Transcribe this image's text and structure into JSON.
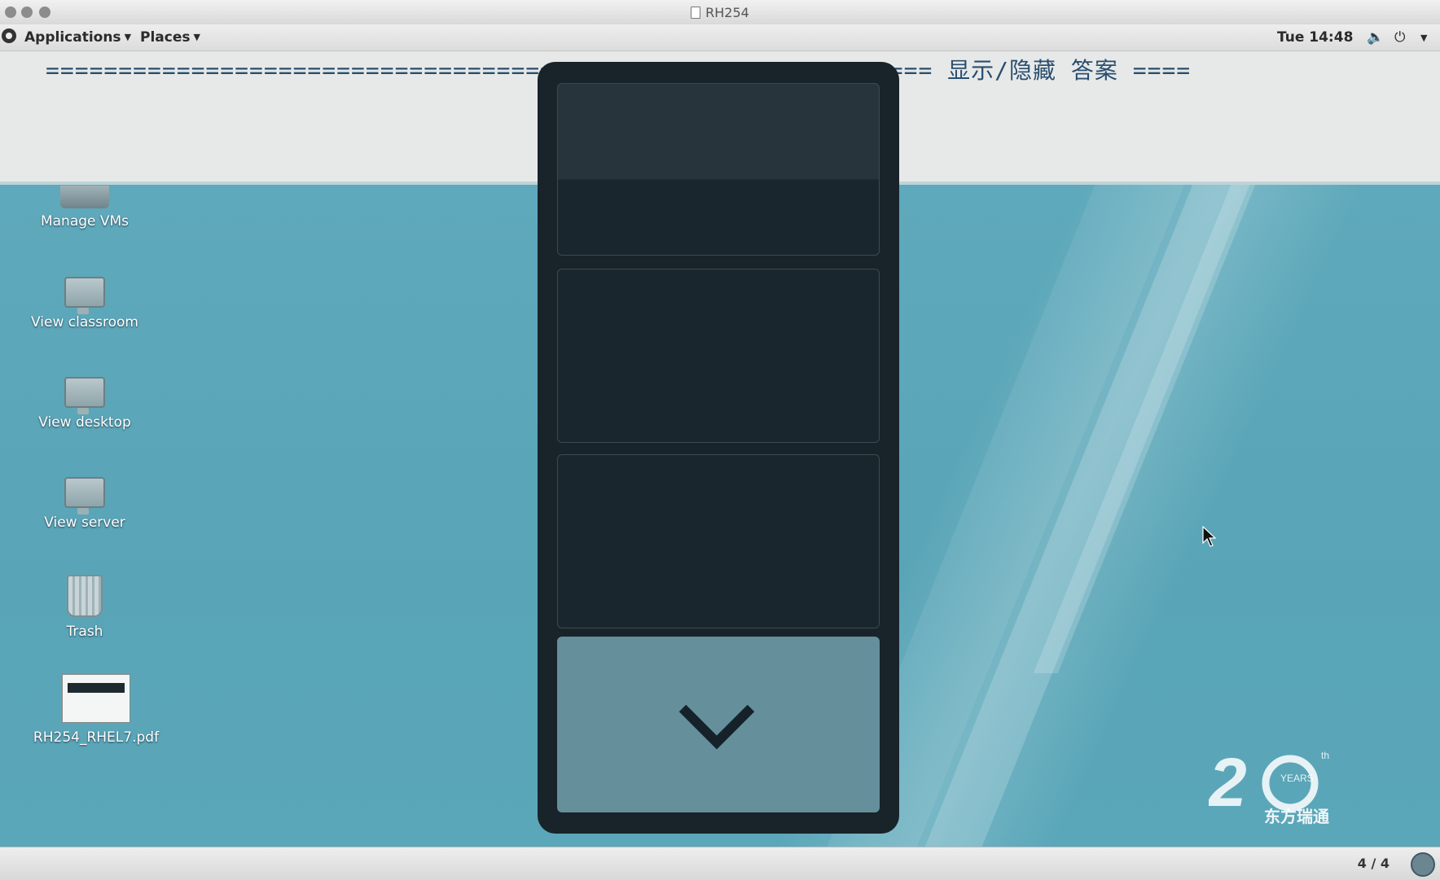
{
  "window": {
    "title": "RH254"
  },
  "panel": {
    "applications_label": "Applications",
    "places_label": "Places",
    "clock": "Tue 14:48"
  },
  "content": {
    "answer_line": "============================================================= 显示/隐藏 答案 ===="
  },
  "desktop": {
    "icons": [
      {
        "label": "Manage VMs",
        "icon": "vm-manager-icon"
      },
      {
        "label": "View classroom",
        "icon": "monitor-icon"
      },
      {
        "label": "View desktop",
        "icon": "monitor-icon"
      },
      {
        "label": "View server",
        "icon": "monitor-icon"
      },
      {
        "label": "Trash",
        "icon": "trash-icon"
      },
      {
        "label": "RH254_RHEL7.pdf",
        "icon": "pdf-thumbnail"
      }
    ],
    "logo_text": {
      "number": "20",
      "suffix": "th",
      "years": "YEARS",
      "company": "东方瑞通"
    }
  },
  "overlay": {
    "button_icon": "chevron-down-icon"
  },
  "status": {
    "workspace": "4 / 4"
  },
  "colors": {
    "desktop": "#5aa6b8",
    "overlay": "#19232a",
    "button": "#668f9c"
  }
}
